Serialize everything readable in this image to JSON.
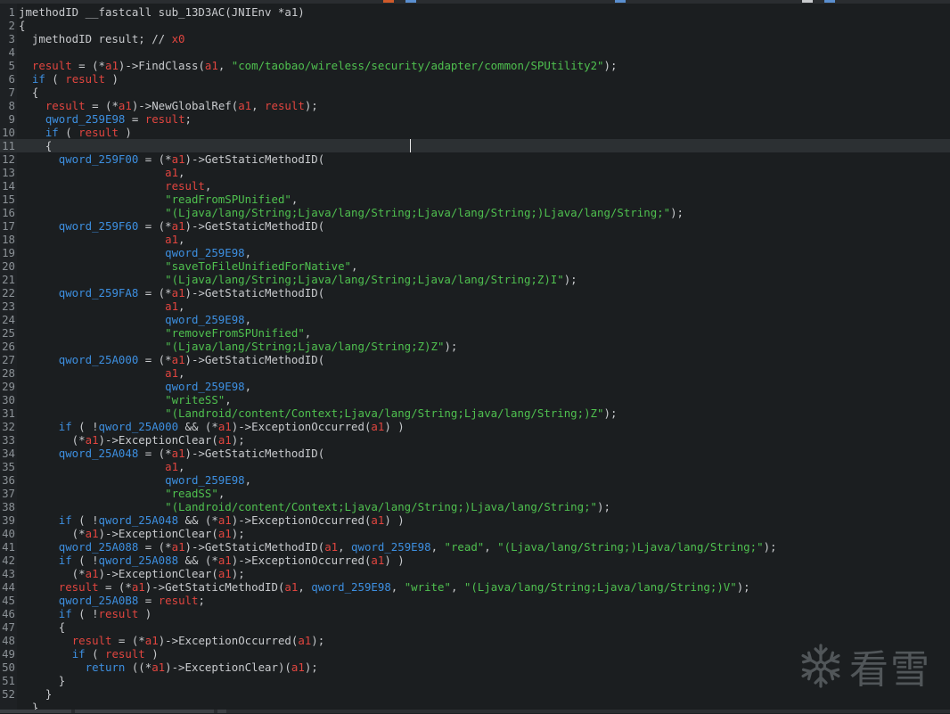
{
  "code_lines": [
    {
      "n": "1",
      "t": [
        [
          "p",
          "jmethodID __fastcall sub_13D3AC(JNIEnv *a1)"
        ]
      ]
    },
    {
      "n": "2",
      "t": [
        [
          "p",
          "{"
        ]
      ]
    },
    {
      "n": "3",
      "t": [
        [
          "p",
          "  jmethodID result; // "
        ],
        [
          "var",
          "x0"
        ]
      ]
    },
    {
      "n": "4",
      "t": []
    },
    {
      "n": "5",
      "t": [
        [
          "p",
          "  "
        ],
        [
          "var",
          "result"
        ],
        [
          "p",
          " = (*"
        ],
        [
          "var",
          "a1"
        ],
        [
          "p",
          ")->FindClass("
        ],
        [
          "var",
          "a1"
        ],
        [
          "p",
          ", "
        ],
        [
          "str",
          "\"com/taobao/wireless/security/adapter/common/SPUtility2\""
        ],
        [
          "p",
          ");"
        ]
      ]
    },
    {
      "n": "6",
      "t": [
        [
          "p",
          "  "
        ],
        [
          "kw",
          "if"
        ],
        [
          "p",
          " ( "
        ],
        [
          "var",
          "result"
        ],
        [
          "p",
          " )"
        ]
      ]
    },
    {
      "n": "7",
      "t": [
        [
          "p",
          "  {"
        ]
      ]
    },
    {
      "n": "8",
      "t": [
        [
          "p",
          "    "
        ],
        [
          "var",
          "result"
        ],
        [
          "p",
          " = (*"
        ],
        [
          "var",
          "a1"
        ],
        [
          "p",
          ")->NewGlobalRef("
        ],
        [
          "var",
          "a1"
        ],
        [
          "p",
          ", "
        ],
        [
          "var",
          "result"
        ],
        [
          "p",
          ");"
        ]
      ]
    },
    {
      "n": "9",
      "t": [
        [
          "p",
          "    "
        ],
        [
          "id",
          "qword_259E98"
        ],
        [
          "p",
          " = "
        ],
        [
          "var",
          "result"
        ],
        [
          "p",
          ";"
        ]
      ]
    },
    {
      "n": "10",
      "t": [
        [
          "p",
          "    "
        ],
        [
          "kw",
          "if"
        ],
        [
          "p",
          " ( "
        ],
        [
          "var",
          "result"
        ],
        [
          "p",
          " )"
        ]
      ]
    },
    {
      "n": "11",
      "t": [
        [
          "p",
          "    {"
        ]
      ],
      "hl": true
    },
    {
      "n": "12",
      "t": [
        [
          "p",
          "      "
        ],
        [
          "id",
          "qword_259F00"
        ],
        [
          "p",
          " = (*"
        ],
        [
          "var",
          "a1"
        ],
        [
          "p",
          ")->GetStaticMethodID("
        ]
      ]
    },
    {
      "n": "13",
      "t": [
        [
          "p",
          "                      "
        ],
        [
          "var",
          "a1"
        ],
        [
          "p",
          ","
        ]
      ]
    },
    {
      "n": "14",
      "t": [
        [
          "p",
          "                      "
        ],
        [
          "var",
          "result"
        ],
        [
          "p",
          ","
        ]
      ]
    },
    {
      "n": "15",
      "t": [
        [
          "p",
          "                      "
        ],
        [
          "str",
          "\"readFromSPUnified\""
        ],
        [
          "p",
          ","
        ]
      ]
    },
    {
      "n": "16",
      "t": [
        [
          "p",
          "                      "
        ],
        [
          "str",
          "\"(Ljava/lang/String;Ljava/lang/String;Ljava/lang/String;)Ljava/lang/String;\""
        ],
        [
          "p",
          ");"
        ]
      ]
    },
    {
      "n": "17",
      "t": [
        [
          "p",
          "      "
        ],
        [
          "id",
          "qword_259F60"
        ],
        [
          "p",
          " = (*"
        ],
        [
          "var",
          "a1"
        ],
        [
          "p",
          ")->GetStaticMethodID("
        ]
      ]
    },
    {
      "n": "18",
      "t": [
        [
          "p",
          "                      "
        ],
        [
          "var",
          "a1"
        ],
        [
          "p",
          ","
        ]
      ]
    },
    {
      "n": "19",
      "t": [
        [
          "p",
          "                      "
        ],
        [
          "id",
          "qword_259E98"
        ],
        [
          "p",
          ","
        ]
      ]
    },
    {
      "n": "20",
      "t": [
        [
          "p",
          "                      "
        ],
        [
          "str",
          "\"saveToFileUnifiedForNative\""
        ],
        [
          "p",
          ","
        ]
      ]
    },
    {
      "n": "21",
      "t": [
        [
          "p",
          "                      "
        ],
        [
          "str",
          "\"(Ljava/lang/String;Ljava/lang/String;Ljava/lang/String;Z)I\""
        ],
        [
          "p",
          ");"
        ]
      ]
    },
    {
      "n": "22",
      "t": [
        [
          "p",
          "      "
        ],
        [
          "id",
          "qword_259FA8"
        ],
        [
          "p",
          " = (*"
        ],
        [
          "var",
          "a1"
        ],
        [
          "p",
          ")->GetStaticMethodID("
        ]
      ]
    },
    {
      "n": "23",
      "t": [
        [
          "p",
          "                      "
        ],
        [
          "var",
          "a1"
        ],
        [
          "p",
          ","
        ]
      ]
    },
    {
      "n": "24",
      "t": [
        [
          "p",
          "                      "
        ],
        [
          "id",
          "qword_259E98"
        ],
        [
          "p",
          ","
        ]
      ]
    },
    {
      "n": "25",
      "t": [
        [
          "p",
          "                      "
        ],
        [
          "str",
          "\"removeFromSPUnified\""
        ],
        [
          "p",
          ","
        ]
      ]
    },
    {
      "n": "26",
      "t": [
        [
          "p",
          "                      "
        ],
        [
          "str",
          "\"(Ljava/lang/String;Ljava/lang/String;Z)Z\""
        ],
        [
          "p",
          ");"
        ]
      ]
    },
    {
      "n": "27",
      "t": [
        [
          "p",
          "      "
        ],
        [
          "id",
          "qword_25A000"
        ],
        [
          "p",
          " = (*"
        ],
        [
          "var",
          "a1"
        ],
        [
          "p",
          ")->GetStaticMethodID("
        ]
      ]
    },
    {
      "n": "28",
      "t": [
        [
          "p",
          "                      "
        ],
        [
          "var",
          "a1"
        ],
        [
          "p",
          ","
        ]
      ]
    },
    {
      "n": "29",
      "t": [
        [
          "p",
          "                      "
        ],
        [
          "id",
          "qword_259E98"
        ],
        [
          "p",
          ","
        ]
      ]
    },
    {
      "n": "30",
      "t": [
        [
          "p",
          "                      "
        ],
        [
          "str",
          "\"writeSS\""
        ],
        [
          "p",
          ","
        ]
      ]
    },
    {
      "n": "31",
      "t": [
        [
          "p",
          "                      "
        ],
        [
          "str",
          "\"(Landroid/content/Context;Ljava/lang/String;Ljava/lang/String;)Z\""
        ],
        [
          "p",
          ");"
        ]
      ]
    },
    {
      "n": "32",
      "t": [
        [
          "p",
          "      "
        ],
        [
          "kw",
          "if"
        ],
        [
          "p",
          " ( !"
        ],
        [
          "id",
          "qword_25A000"
        ],
        [
          "p",
          " && (*"
        ],
        [
          "var",
          "a1"
        ],
        [
          "p",
          ")->ExceptionOccurred("
        ],
        [
          "var",
          "a1"
        ],
        [
          "p",
          ") )"
        ]
      ]
    },
    {
      "n": "33",
      "t": [
        [
          "p",
          "        (*"
        ],
        [
          "var",
          "a1"
        ],
        [
          "p",
          ")->ExceptionClear("
        ],
        [
          "var",
          "a1"
        ],
        [
          "p",
          ");"
        ]
      ]
    },
    {
      "n": "34",
      "t": [
        [
          "p",
          "      "
        ],
        [
          "id",
          "qword_25A048"
        ],
        [
          "p",
          " = (*"
        ],
        [
          "var",
          "a1"
        ],
        [
          "p",
          ")->GetStaticMethodID("
        ]
      ]
    },
    {
      "n": "35",
      "t": [
        [
          "p",
          "                      "
        ],
        [
          "var",
          "a1"
        ],
        [
          "p",
          ","
        ]
      ]
    },
    {
      "n": "36",
      "t": [
        [
          "p",
          "                      "
        ],
        [
          "id",
          "qword_259E98"
        ],
        [
          "p",
          ","
        ]
      ]
    },
    {
      "n": "37",
      "t": [
        [
          "p",
          "                      "
        ],
        [
          "str",
          "\"readSS\""
        ],
        [
          "p",
          ","
        ]
      ]
    },
    {
      "n": "38",
      "t": [
        [
          "p",
          "                      "
        ],
        [
          "str",
          "\"(Landroid/content/Context;Ljava/lang/String;)Ljava/lang/String;\""
        ],
        [
          "p",
          ");"
        ]
      ]
    },
    {
      "n": "39",
      "t": [
        [
          "p",
          "      "
        ],
        [
          "kw",
          "if"
        ],
        [
          "p",
          " ( !"
        ],
        [
          "id",
          "qword_25A048"
        ],
        [
          "p",
          " && (*"
        ],
        [
          "var",
          "a1"
        ],
        [
          "p",
          ")->ExceptionOccurred("
        ],
        [
          "var",
          "a1"
        ],
        [
          "p",
          ") )"
        ]
      ]
    },
    {
      "n": "40",
      "t": [
        [
          "p",
          "        (*"
        ],
        [
          "var",
          "a1"
        ],
        [
          "p",
          ")->ExceptionClear("
        ],
        [
          "var",
          "a1"
        ],
        [
          "p",
          ");"
        ]
      ]
    },
    {
      "n": "41",
      "t": [
        [
          "p",
          "      "
        ],
        [
          "id",
          "qword_25A088"
        ],
        [
          "p",
          " = (*"
        ],
        [
          "var",
          "a1"
        ],
        [
          "p",
          ")->GetStaticMethodID("
        ],
        [
          "var",
          "a1"
        ],
        [
          "p",
          ", "
        ],
        [
          "id",
          "qword_259E98"
        ],
        [
          "p",
          ", "
        ],
        [
          "str",
          "\"read\""
        ],
        [
          "p",
          ", "
        ],
        [
          "str",
          "\"(Ljava/lang/String;)Ljava/lang/String;\""
        ],
        [
          "p",
          ");"
        ]
      ]
    },
    {
      "n": "42",
      "t": [
        [
          "p",
          "      "
        ],
        [
          "kw",
          "if"
        ],
        [
          "p",
          " ( !"
        ],
        [
          "id",
          "qword_25A088"
        ],
        [
          "p",
          " && (*"
        ],
        [
          "var",
          "a1"
        ],
        [
          "p",
          ")->ExceptionOccurred("
        ],
        [
          "var",
          "a1"
        ],
        [
          "p",
          ") )"
        ]
      ]
    },
    {
      "n": "43",
      "t": [
        [
          "p",
          "        (*"
        ],
        [
          "var",
          "a1"
        ],
        [
          "p",
          ")->ExceptionClear("
        ],
        [
          "var",
          "a1"
        ],
        [
          "p",
          ");"
        ]
      ]
    },
    {
      "n": "44",
      "t": [
        [
          "p",
          "      "
        ],
        [
          "var",
          "result"
        ],
        [
          "p",
          " = (*"
        ],
        [
          "var",
          "a1"
        ],
        [
          "p",
          ")->GetStaticMethodID("
        ],
        [
          "var",
          "a1"
        ],
        [
          "p",
          ", "
        ],
        [
          "id",
          "qword_259E98"
        ],
        [
          "p",
          ", "
        ],
        [
          "str",
          "\"write\""
        ],
        [
          "p",
          ", "
        ],
        [
          "str",
          "\"(Ljava/lang/String;Ljava/lang/String;)V\""
        ],
        [
          "p",
          ");"
        ]
      ]
    },
    {
      "n": "45",
      "t": [
        [
          "p",
          "      "
        ],
        [
          "id",
          "qword_25A0B8"
        ],
        [
          "p",
          " = "
        ],
        [
          "var",
          "result"
        ],
        [
          "p",
          ";"
        ]
      ]
    },
    {
      "n": "46",
      "t": [
        [
          "p",
          "      "
        ],
        [
          "kw",
          "if"
        ],
        [
          "p",
          " ( !"
        ],
        [
          "var",
          "result"
        ],
        [
          "p",
          " )"
        ]
      ]
    },
    {
      "n": "47",
      "t": [
        [
          "p",
          "      {"
        ]
      ]
    },
    {
      "n": "48",
      "t": [
        [
          "p",
          "        "
        ],
        [
          "var",
          "result"
        ],
        [
          "p",
          " = (*"
        ],
        [
          "var",
          "a1"
        ],
        [
          "p",
          ")->ExceptionOccurred("
        ],
        [
          "var",
          "a1"
        ],
        [
          "p",
          ");"
        ]
      ]
    },
    {
      "n": "49",
      "t": [
        [
          "p",
          "        "
        ],
        [
          "kw",
          "if"
        ],
        [
          "p",
          " ( "
        ],
        [
          "var",
          "result"
        ],
        [
          "p",
          " )"
        ]
      ]
    },
    {
      "n": "50",
      "t": [
        [
          "p",
          "          "
        ],
        [
          "kw",
          "return"
        ],
        [
          "p",
          " ((*"
        ],
        [
          "var",
          "a1"
        ],
        [
          "p",
          ")->ExceptionClear)("
        ],
        [
          "var",
          "a1"
        ],
        [
          "p",
          ");"
        ]
      ]
    },
    {
      "n": "51",
      "t": [
        [
          "p",
          "      }"
        ]
      ]
    },
    {
      "n": "52",
      "t": [
        [
          "p",
          "    }"
        ]
      ]
    },
    {
      "n": "",
      "t": [
        [
          "p",
          "  }"
        ]
      ]
    }
  ],
  "watermark": {
    "icon": "snowflake-icon",
    "text": "看雪"
  },
  "colors": {
    "background": "#1b1e20",
    "plain": "#c8cacd",
    "keyword": "#3d8fe0",
    "variable": "#e0453f",
    "string": "#4fc04f",
    "current_line": "#2c3033"
  }
}
